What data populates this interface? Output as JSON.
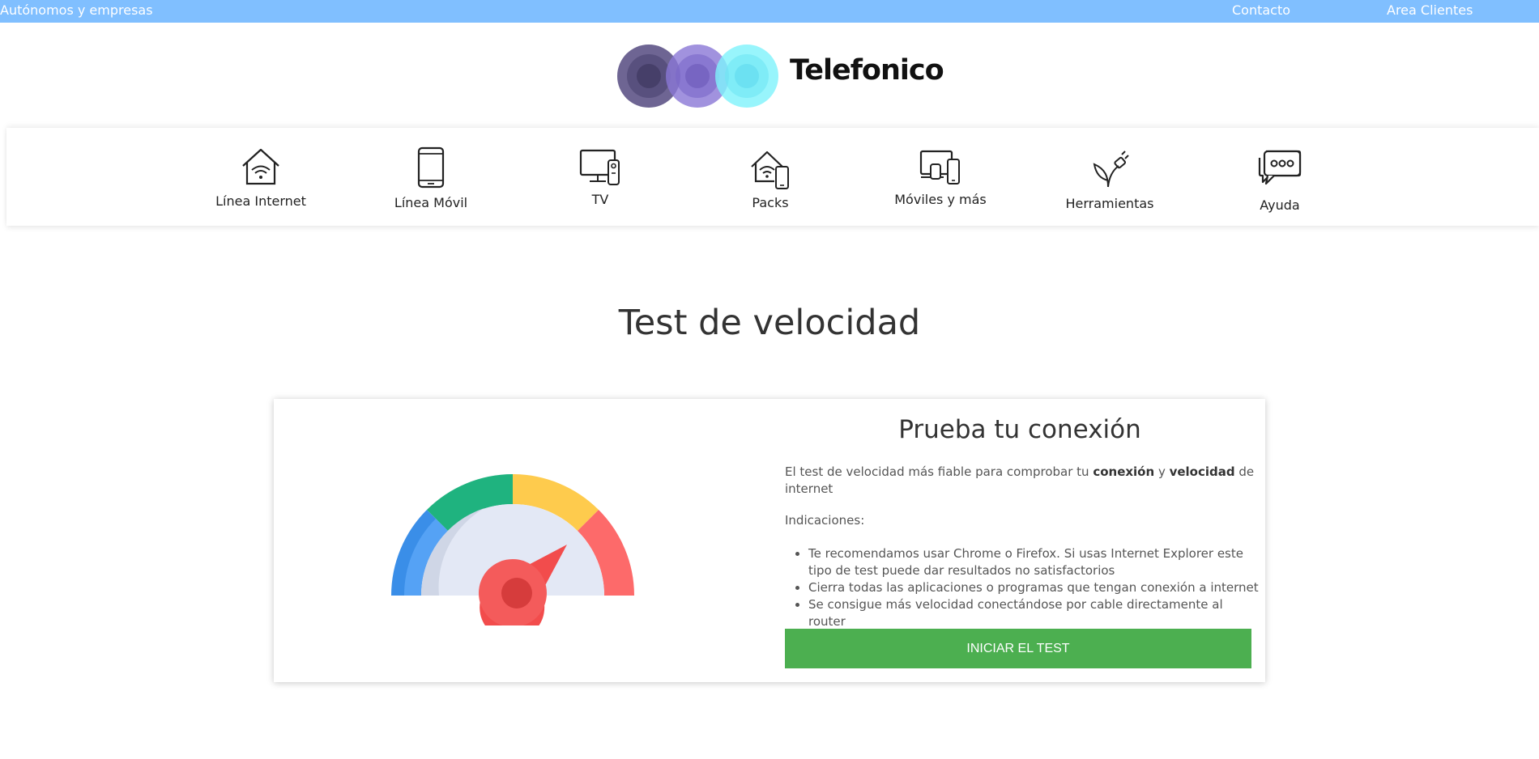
{
  "topbar": {
    "left_link": "Autónomos y empresas",
    "contact": "Contacto",
    "clients": "Area Clientes",
    "bg_color": "#80bfff"
  },
  "brand": {
    "name": "Telefonico"
  },
  "nav": {
    "items": [
      {
        "label": "Línea Internet",
        "icon": "house-wifi-icon"
      },
      {
        "label": "Línea Móvil",
        "icon": "smartphone-icon"
      },
      {
        "label": "TV",
        "icon": "tv-remote-icon"
      },
      {
        "label": "Packs",
        "icon": "house-phone-icon"
      },
      {
        "label": "Móviles y más",
        "icon": "devices-icon"
      },
      {
        "label": "Herramientas",
        "icon": "plug-leaf-icon"
      },
      {
        "label": "Ayuda",
        "icon": "chat-bubble-icon"
      }
    ]
  },
  "main": {
    "title": "Test de velocidad",
    "card": {
      "heading": "Prueba tu conexión",
      "desc_pre": "El test de velocidad más fiable para comprobar tu ",
      "desc_bold1": "conexión",
      "desc_mid": " y ",
      "desc_bold2": "velocidad",
      "desc_post": " de internet",
      "indications_label": "Indicaciones:",
      "bullets": [
        "Te recomendamos usar Chrome o Firefox. Si usas Internet Explorer este tipo de test puede dar resultados no satisfactorios",
        "Cierra todas las aplicaciones o programas que tengan conexión a internet",
        "Se consigue más velocidad conectándose por cable directamente al router"
      ],
      "button_label": "INICIAR EL TEST",
      "button_color": "#4caf50",
      "gauge_icon": "speedometer-icon"
    }
  }
}
